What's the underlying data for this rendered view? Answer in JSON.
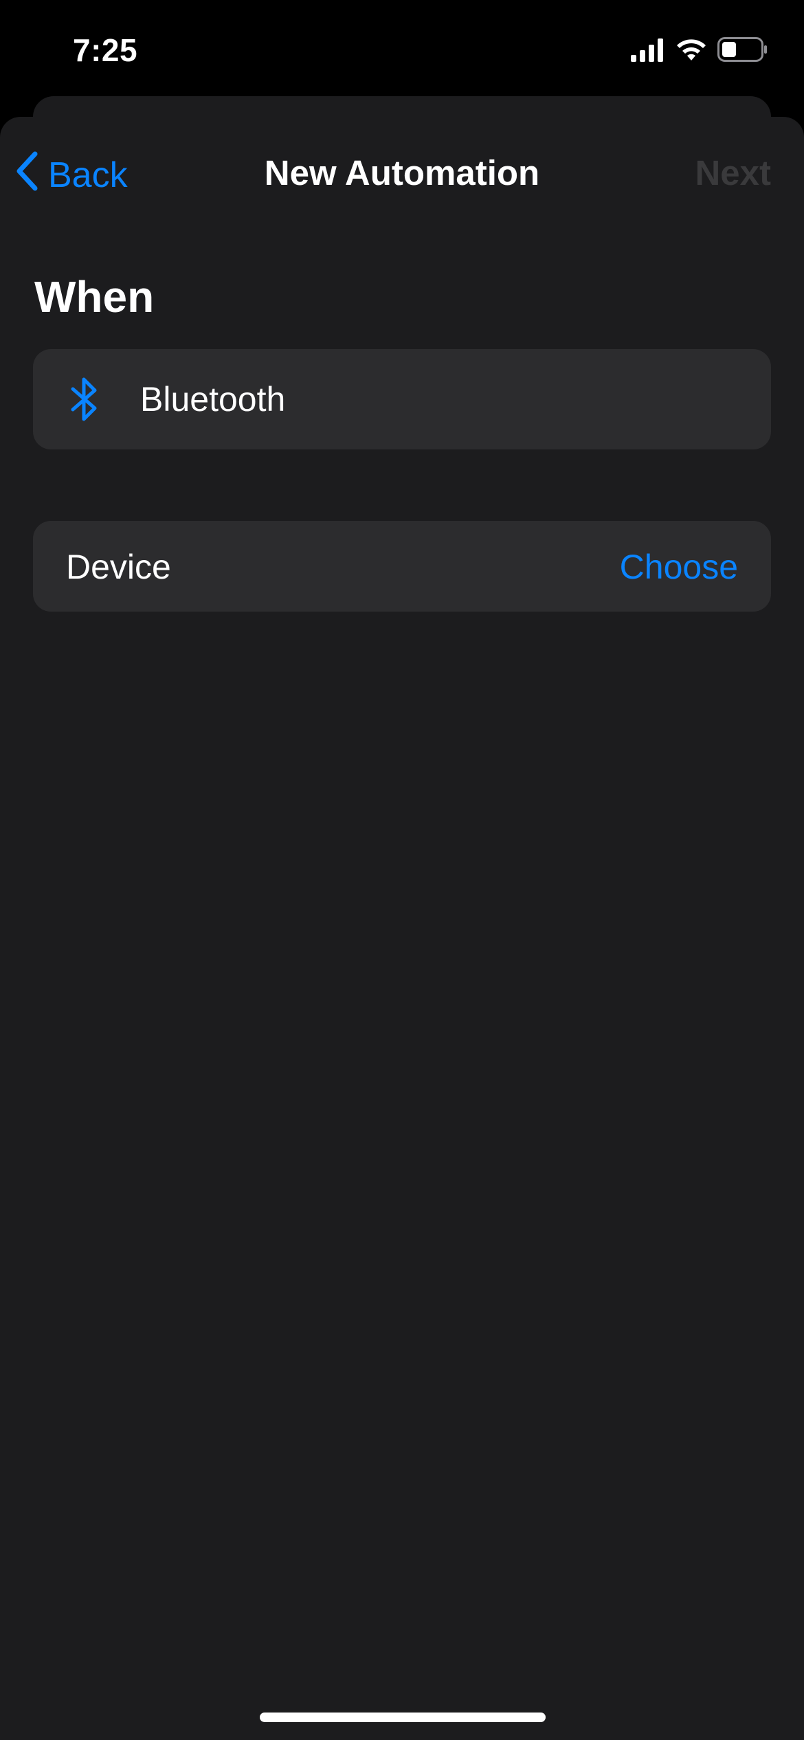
{
  "status_bar": {
    "time": "7:25",
    "icons": [
      "cellular-signal-icon",
      "wifi-icon",
      "battery-icon"
    ]
  },
  "nav": {
    "back_label": "Back",
    "title": "New Automation",
    "next_label": "Next"
  },
  "section": {
    "heading": "When"
  },
  "trigger": {
    "icon": "bluetooth-icon",
    "label": "Bluetooth"
  },
  "device_row": {
    "label": "Device",
    "action": "Choose"
  },
  "colors": {
    "accent": "#0a84ff",
    "background": "#1c1c1e",
    "card": "#2c2c2e",
    "disabled": "#3a3a3c"
  }
}
